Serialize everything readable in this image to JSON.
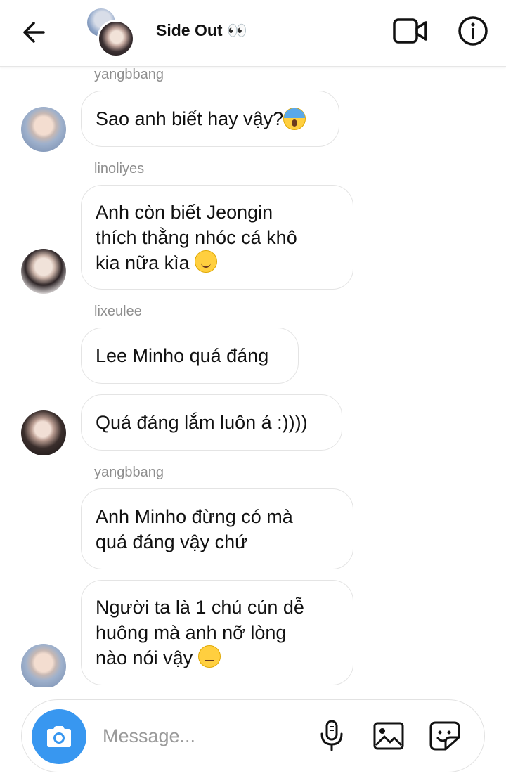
{
  "header": {
    "title": "Side Out 👀",
    "back_icon": "arrow-left-icon",
    "video_icon": "video-camera-icon",
    "info_icon": "info-icon"
  },
  "messages": [
    {
      "sender": "yangbbang",
      "text": "Sao anh biết hay vậy? ",
      "emoji": "face-screaming-in-fear"
    },
    {
      "sender": "linoliyes",
      "text": "Anh còn biết Jeongin\nthích thằng nhóc cá khô\nkia nữa kìa ",
      "emoji": "relieved-face"
    },
    {
      "sender": "lixeulee",
      "text": "Lee Minho quá đáng"
    },
    {
      "text": "Quá đáng lắm luôn á :))))"
    },
    {
      "sender": "yangbbang",
      "text": "Anh Minho đừng có mà\nquá đáng vậy chứ"
    },
    {
      "text": "Người ta là 1 chú cún dễ\nhuông mà anh nỡ lòng\nnào nói vậy ",
      "emoji": "unamused-face"
    }
  ],
  "composer": {
    "placeholder": "Message...",
    "camera_icon": "camera-icon",
    "mic_icon": "microphone-icon",
    "gallery_icon": "image-icon",
    "sticker_icon": "sticker-icon"
  },
  "colors": {
    "accent": "#3897f0",
    "sender_text": "#8e8e8e",
    "bubble_border": "#e4e4e4"
  }
}
